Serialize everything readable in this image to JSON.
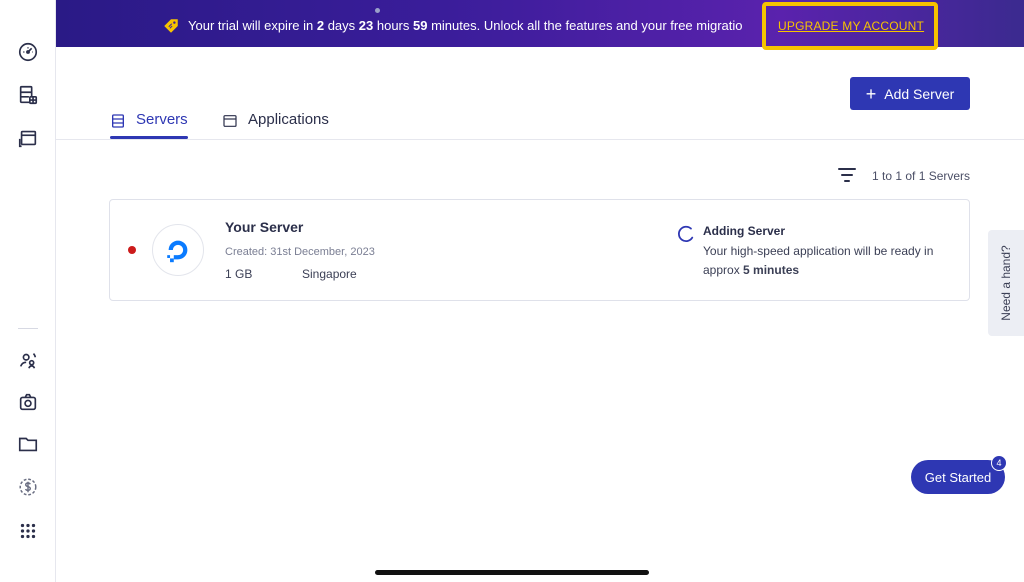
{
  "banner": {
    "prefix": "Your trial will expire in ",
    "days": "2",
    "days_label": " days ",
    "hours": "23",
    "hours_label": " hours ",
    "minutes": "59",
    "minutes_suffix": " minutes. Unlock all the features and your free migratio",
    "upgrade_label": "UPGRADE MY ACCOUNT",
    "tag_icon": "tag-icon",
    "highlight_color": "#f7c300"
  },
  "sidebar": {
    "items": [
      {
        "icon": "dashboard-gauge-icon"
      },
      {
        "icon": "servers-grid-icon"
      },
      {
        "icon": "application-window-icon"
      },
      {
        "icon": "team-users-icon"
      },
      {
        "icon": "addons-camera-icon"
      },
      {
        "icon": "folder-icon"
      },
      {
        "icon": "billing-dollar-icon"
      },
      {
        "icon": "apps-grid-icon"
      }
    ]
  },
  "toolbar": {
    "add_server_label": "Add Server",
    "accent_color": "#2e37b3"
  },
  "tabs": [
    {
      "label": "Servers",
      "active": true,
      "icon": "server-list-icon"
    },
    {
      "label": "Applications",
      "active": false,
      "icon": "application-window-icon"
    }
  ],
  "list": {
    "count_text": "1 to 1 of 1 Servers",
    "filter_icon": "filter-icon"
  },
  "server": {
    "name": "Your Server",
    "created": "Created: 31st December, 2023",
    "size": "1 GB",
    "location": "Singapore",
    "status_color": "#cc1b1b",
    "provider_icon": "digitalocean-logo-icon",
    "status_title": "Adding Server",
    "status_desc_prefix": "Your high-speed application will be ready in approx ",
    "status_desc_time": "5 minutes"
  },
  "help": {
    "need_hand_label": "Need a hand?",
    "get_started_label": "Get Started",
    "get_started_badge": "4"
  }
}
